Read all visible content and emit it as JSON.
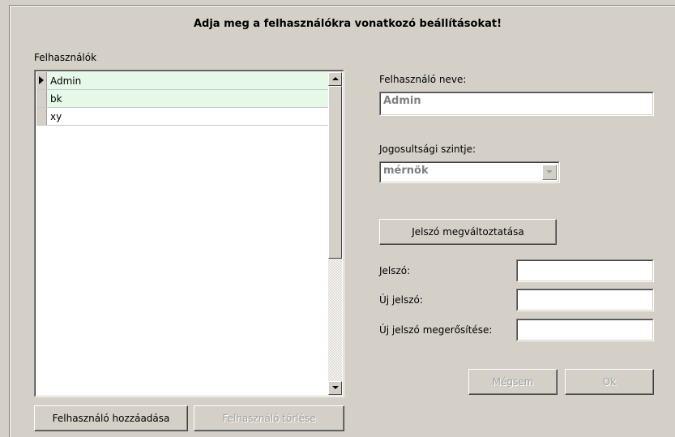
{
  "header": {
    "title": "Adja meg a felhasználókra vonatkozó beállításokat!"
  },
  "users_panel": {
    "label": "Felhasználók",
    "users": [
      "Admin",
      "bk",
      "xy"
    ],
    "selected_user": "Admin"
  },
  "details": {
    "username_label": "Felhasználó neve:",
    "username_value": "Admin",
    "role_label": "Jogosultsági szintje:",
    "role_value": "mérnök",
    "change_password_button": "Jelszó megváltoztatása",
    "password_label": "Jelszó:",
    "new_password_label": "Új jelszó:",
    "confirm_password_label": "Új jelszó megerősítése:",
    "password_value": "",
    "new_password_value": "",
    "confirm_password_value": "",
    "cancel_button": "Mégsem",
    "ok_button": "Ok"
  },
  "footer": {
    "add_user_button": "Felhasználó hozzáadása",
    "delete_user_button": "Felhasználó törlése"
  }
}
